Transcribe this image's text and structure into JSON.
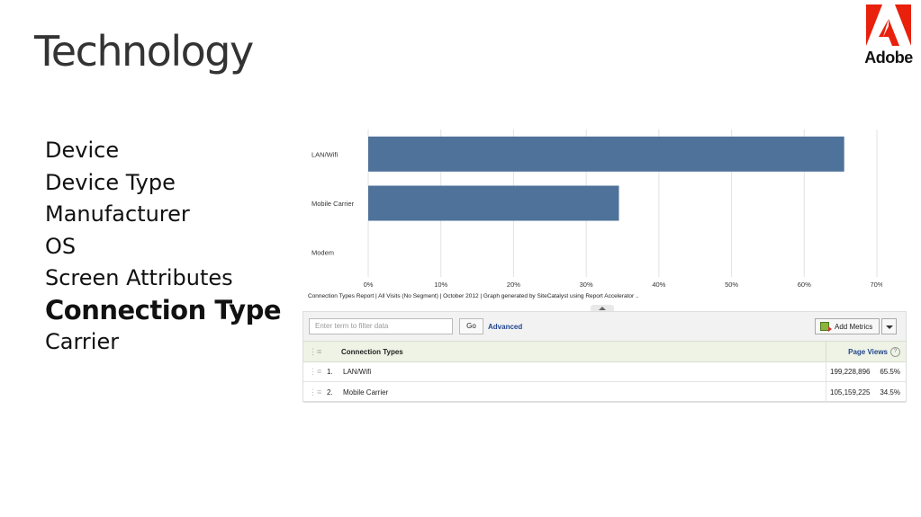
{
  "slide": {
    "title": "Technology"
  },
  "logo": {
    "text": "Adobe",
    "color": "#e8200c"
  },
  "menu": [
    {
      "label": "Device",
      "active": false
    },
    {
      "label": "Device Type",
      "active": false
    },
    {
      "label": "Manufacturer",
      "active": false
    },
    {
      "label": "OS",
      "active": false
    },
    {
      "label": "Screen Attributes",
      "active": false
    },
    {
      "label": "Connection Type",
      "active": true
    },
    {
      "label": "Carrier",
      "active": false
    }
  ],
  "chart_data": {
    "type": "bar",
    "orientation": "horizontal",
    "categories": [
      "LAN/Wifi",
      "Mobile Carrier",
      "Modem"
    ],
    "values": [
      65.5,
      34.5,
      0
    ],
    "xlim": [
      0,
      70
    ],
    "x_ticks": [
      "0%",
      "10%",
      "20%",
      "30%",
      "40%",
      "50%",
      "60%",
      "70%"
    ],
    "grid": true,
    "bar_color": "#4e7299"
  },
  "report": {
    "caption": "Connection Types Report | All Visits (No Segment) | October 2012 | Graph generated by SiteCatalyst using Report Accelerator .."
  },
  "toolbar": {
    "filter_placeholder": "Enter term to filter data",
    "go_label": "Go",
    "advanced_label": "Advanced",
    "add_metrics_label": "Add Metrics"
  },
  "table": {
    "col_header": "Connection Types",
    "value_header": "Page Views",
    "rows": [
      {
        "rank": "1.",
        "label": "LAN/Wifi",
        "value": "199,228,896",
        "pct": "65.5%"
      },
      {
        "rank": "2.",
        "label": "Mobile Carrier",
        "value": "105,159,225",
        "pct": "34.5%"
      }
    ]
  }
}
